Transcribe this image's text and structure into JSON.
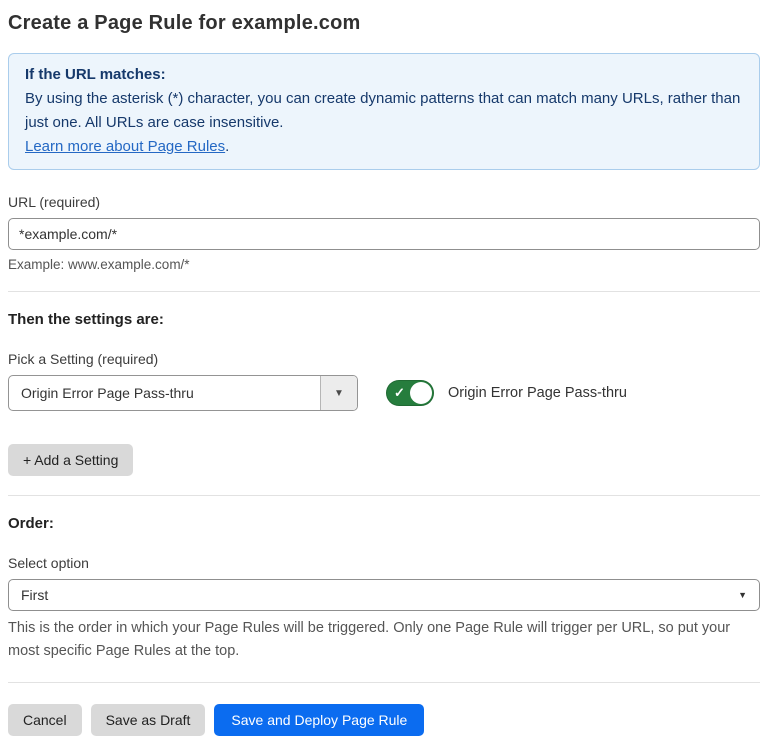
{
  "page": {
    "title": "Create a Page Rule for example.com"
  },
  "info_box": {
    "heading": "If the URL matches:",
    "body": "By using the asterisk (*) character, you can create dynamic patterns that can match many URLs, rather than just one. All URLs are case insensitive.",
    "link_label": "Learn more about Page Rules",
    "link_suffix": "."
  },
  "url_field": {
    "label": "URL (required)",
    "value": "*example.com/*",
    "helper": "Example: www.example.com/*"
  },
  "settings_section": {
    "heading": "Then the settings are:",
    "picker_label": "Pick a Setting (required)",
    "picker_value": "Origin Error Page Pass-thru",
    "picker_caret_icon": "▼",
    "toggle_state": "on",
    "toggle_check_icon": "✓",
    "toggle_label": "Origin Error Page Pass-thru",
    "add_setting_button": "+ Add a Setting"
  },
  "order_section": {
    "heading": "Order:",
    "select_label": "Select option",
    "select_value": "First",
    "select_caret_icon": "▼",
    "helper": "This is the order in which your Page Rules will be triggered. Only one Page Rule will trigger per URL, so put your most specific Page Rules at the top."
  },
  "footer": {
    "cancel_label": "Cancel",
    "save_draft_label": "Save as Draft",
    "save_deploy_label": "Save and Deploy Page Rule"
  },
  "colors": {
    "info_bg": "#edf5fc",
    "info_border": "#aacdec",
    "info_text": "#16396b",
    "link": "#2468c4",
    "toggle_on": "#267d3d",
    "primary_button": "#0b6cf0",
    "secondary_button": "#d9d9d9"
  }
}
